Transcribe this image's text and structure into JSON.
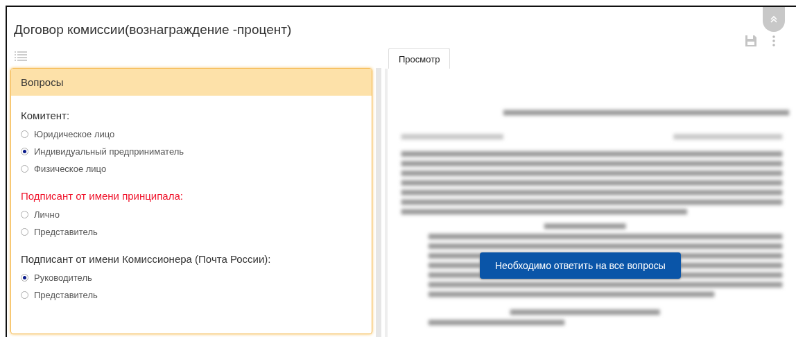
{
  "title": "Договор комиссии(вознаграждение -процент)",
  "questions_panel": {
    "header": "Вопросы",
    "questions": [
      {
        "label": "Комитент:",
        "unanswered": false,
        "options": [
          {
            "label": "Юридическое лицо",
            "selected": false
          },
          {
            "label": "Индивидуальный предприниматель",
            "selected": true
          },
          {
            "label": "Физическое лицо",
            "selected": false
          }
        ]
      },
      {
        "label": "Подписант от имени принципала:",
        "unanswered": true,
        "options": [
          {
            "label": "Лично",
            "selected": false
          },
          {
            "label": "Представитель",
            "selected": false
          }
        ]
      },
      {
        "label": "Подписант от имени Комиссионера (Почта России):",
        "unanswered": false,
        "options": [
          {
            "label": "Руководитель",
            "selected": true
          },
          {
            "label": "Представитель",
            "selected": false
          }
        ]
      }
    ]
  },
  "preview": {
    "tabs": [
      {
        "label": "Просмотр",
        "selected": true
      }
    ],
    "notice_button": "Необходимо ответить на все вопросы"
  }
}
